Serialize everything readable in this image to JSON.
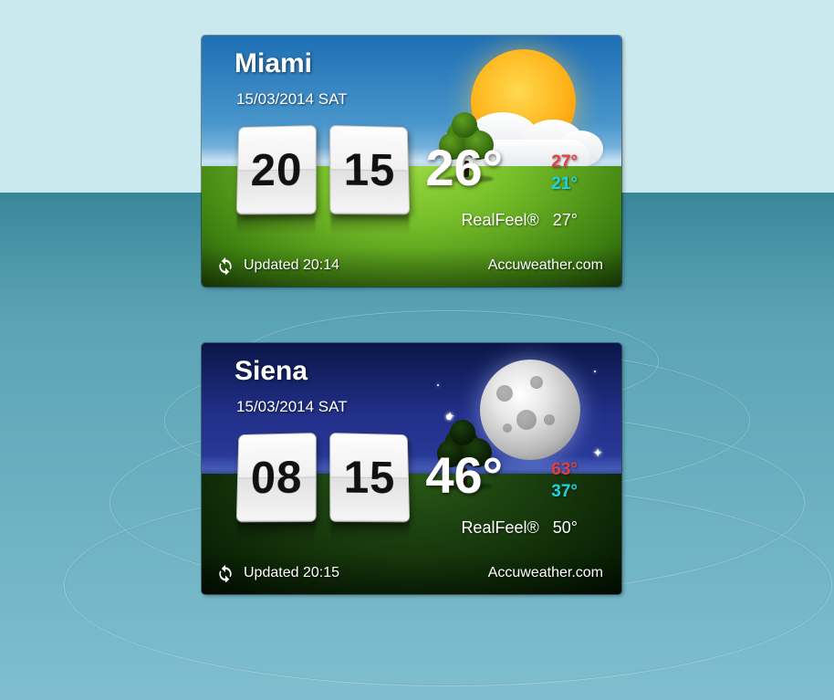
{
  "widgets": [
    {
      "city": "Miami",
      "date": "15/03/2014 SAT",
      "clock": {
        "hours": "20",
        "minutes": "15"
      },
      "temp": "26°",
      "hi": "27°",
      "lo": "21°",
      "realfeel_label": "RealFeel®",
      "realfeel_value": "27°",
      "updated_label": "Updated",
      "updated_time": "20:14",
      "source": "Accuweather.com",
      "theme": "day"
    },
    {
      "city": "Siena",
      "date": "15/03/2014 SAT",
      "clock": {
        "hours": "08",
        "minutes": "15"
      },
      "temp": "46°",
      "hi": "63°",
      "lo": "37°",
      "realfeel_label": "RealFeel®",
      "realfeel_value": "50°",
      "updated_label": "Updated",
      "updated_time": "20:15",
      "source": "Accuweather.com",
      "theme": "night"
    }
  ]
}
